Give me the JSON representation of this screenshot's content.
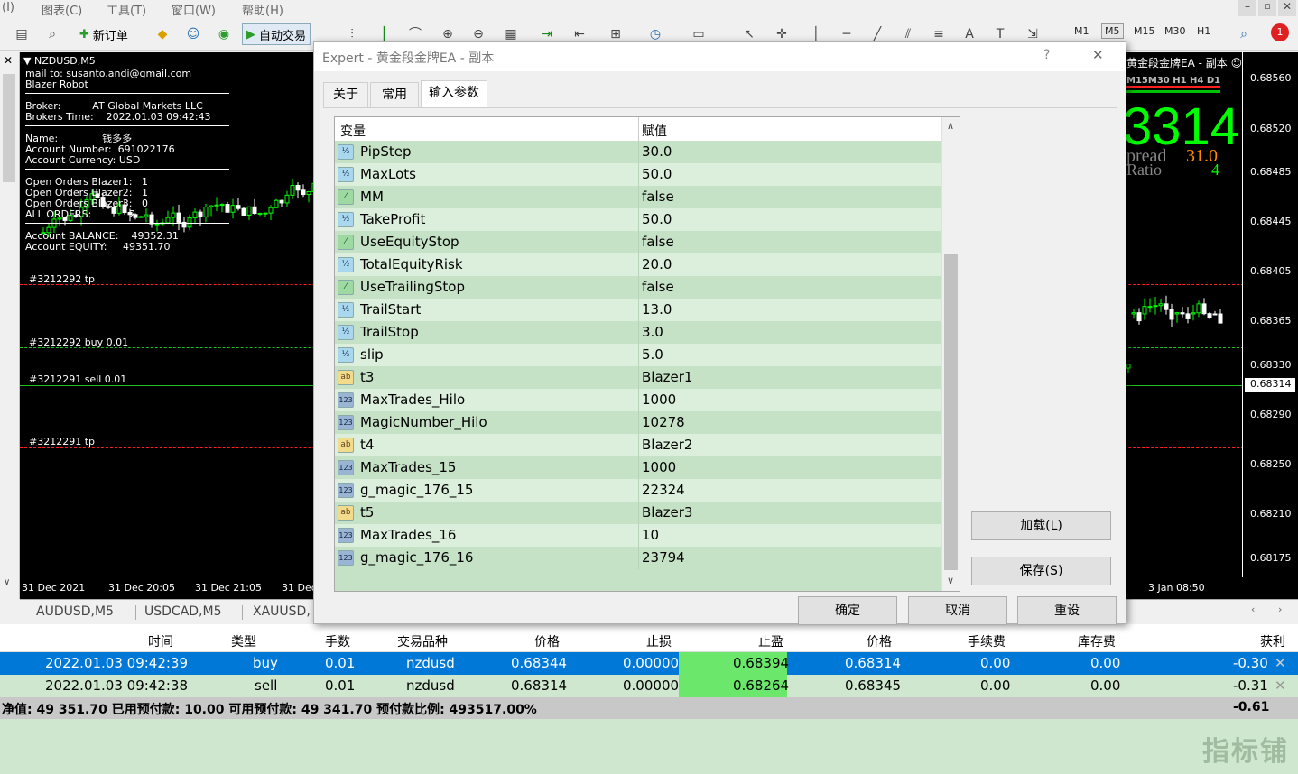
{
  "menu": {
    "items": [
      "(I)",
      "图表(C)",
      "工具(T)",
      "窗口(W)",
      "帮助(H)"
    ]
  },
  "toolbar": {
    "new_order": "新订单",
    "auto_trading": "自动交易",
    "timeframes": [
      "M1",
      "M5",
      "M15",
      "M30",
      "H1"
    ],
    "notification_count": "1"
  },
  "chart": {
    "symbol": "NZDUSD,M5",
    "ea_label": "黄金段金牌EA - 副本",
    "info_lines": [
      "mail to: susanto.andi@gmail.com",
      "Blazer Robot",
      "Broker:          AT Global Markets LLC",
      "Brokers Time:    2022.01.03 09:42:43",
      "Name:              钱多多",
      "Account Number:  691022176",
      "Account Currency: USD",
      "Open Orders Blazer1:   1",
      "Open Orders Blazer2:   1",
      "Open Orders Blazer3:   0",
      "ALL ORDERS:            2",
      "Account BALANCE:    49352.31",
      "Account EQUITY:     49351.70"
    ],
    "order_labels": [
      "#3212292 tp",
      "#3212292 buy 0.01",
      "#3212291 sell 0.01",
      "#3212291 tp"
    ],
    "right_panel": {
      "big_number": "3314",
      "tf_row": "M15M30 H1 H4 D1",
      "spread_label": "pread",
      "spread_value": "31.0",
      "ratio_label": "Ratio",
      "ratio_value": "4"
    },
    "price_levels": [
      "0.68560",
      "0.68520",
      "0.68485",
      "0.68445",
      "0.68405",
      "0.68365",
      "0.68330",
      "0.68314",
      "0.68290",
      "0.68250",
      "0.68210",
      "0.68175"
    ],
    "time_labels": [
      "31 Dec 2021",
      "31 Dec 20:05",
      "31 Dec 21:05",
      "31 Dec",
      "3 Jan 08:50"
    ],
    "colors": {
      "bull": "#00ff00",
      "bear": "#ffffff",
      "sl_line": "#ff2020",
      "tp_line": "#20c020"
    }
  },
  "symbol_tabs": [
    "AUDUSD,M5",
    "USDCAD,M5",
    "XAUUSD,"
  ],
  "dialog": {
    "title": "Expert - 黄金段金牌EA - 副本",
    "help": "?",
    "close": "✕",
    "tabs": [
      "关于",
      "常用",
      "输入参数"
    ],
    "active_tab": "输入参数",
    "columns": [
      "变量",
      "赋值"
    ],
    "params": [
      {
        "type": "num",
        "name": "PipStep",
        "value": "30.0"
      },
      {
        "type": "num",
        "name": "MaxLots",
        "value": "50.0"
      },
      {
        "type": "bool",
        "name": "MM",
        "value": "false"
      },
      {
        "type": "num",
        "name": "TakeProfit",
        "value": "50.0"
      },
      {
        "type": "bool",
        "name": "UseEquityStop",
        "value": "false"
      },
      {
        "type": "num",
        "name": "TotalEquityRisk",
        "value": "20.0"
      },
      {
        "type": "bool",
        "name": "UseTrailingStop",
        "value": "false"
      },
      {
        "type": "num",
        "name": "TrailStart",
        "value": "13.0"
      },
      {
        "type": "num",
        "name": "TrailStop",
        "value": "3.0"
      },
      {
        "type": "num",
        "name": "slip",
        "value": "5.0"
      },
      {
        "type": "str",
        "name": "t3",
        "value": "Blazer1"
      },
      {
        "type": "int",
        "name": "MaxTrades_Hilo",
        "value": "1000"
      },
      {
        "type": "int",
        "name": "MagicNumber_Hilo",
        "value": "10278"
      },
      {
        "type": "str",
        "name": "t4",
        "value": "Blazer2"
      },
      {
        "type": "int",
        "name": "MaxTrades_15",
        "value": "1000"
      },
      {
        "type": "int",
        "name": "g_magic_176_15",
        "value": "22324"
      },
      {
        "type": "str",
        "name": "t5",
        "value": "Blazer3"
      },
      {
        "type": "int",
        "name": "MaxTrades_16",
        "value": "10"
      },
      {
        "type": "int",
        "name": "g_magic_176_16",
        "value": "23794"
      }
    ],
    "icon_text": {
      "num": "½",
      "bool": "⁄",
      "str": "ab",
      "int": "123"
    },
    "load_button": "加载(L)",
    "save_button": "保存(S)",
    "ok_button": "确定",
    "cancel_button": "取消",
    "reset_button": "重设"
  },
  "terminal": {
    "headers": [
      "时间",
      "类型",
      "手数",
      "交易品种",
      "价格",
      "止损",
      "止盈",
      "价格",
      "手续费",
      "库存费",
      "获利"
    ],
    "rows": [
      {
        "time": "2022.01.03 09:42:39",
        "type": "buy",
        "lots": "0.01",
        "symbol": "nzdusd",
        "price": "0.68344",
        "sl": "0.00000",
        "tp": "0.68394",
        "cur": "0.68314",
        "commission": "0.00",
        "swap": "0.00",
        "profit": "-0.30"
      },
      {
        "time": "2022.01.03 09:42:38",
        "type": "sell",
        "lots": "0.01",
        "symbol": "nzdusd",
        "price": "0.68314",
        "sl": "0.00000",
        "tp": "0.68264",
        "cur": "0.68345",
        "commission": "0.00",
        "swap": "0.00",
        "profit": "-0.31"
      }
    ],
    "summary": "净值: 49 351.70  已用预付款: 10.00  可用预付款: 49 341.70  预付款比例: 493517.00%",
    "total_profit": "-0.61",
    "watermark": "指标铺"
  }
}
